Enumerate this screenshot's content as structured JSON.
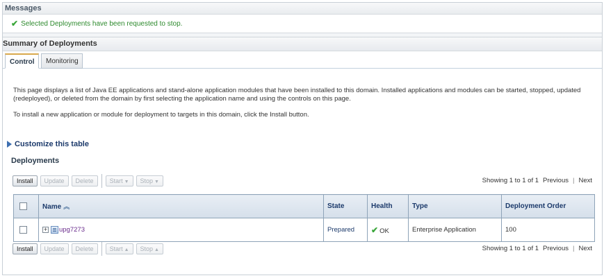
{
  "messages": {
    "header": "Messages",
    "text": "Selected Deployments have been requested to stop."
  },
  "summary": {
    "header": "Summary of Deployments",
    "tabs": [
      {
        "label": "Control",
        "active": true
      },
      {
        "label": "Monitoring",
        "active": false
      }
    ]
  },
  "description": {
    "paragraph1": "This page displays a list of Java EE applications and stand-alone application modules that have been installed to this domain. Installed applications and modules can be started, stopped, updated (redeployed), or deleted from the domain by first selecting the application name and using the controls on this page.",
    "paragraph2": "To install a new application or module for deployment to targets in this domain, click the Install button."
  },
  "customize_label": "Customize this table",
  "deployments": {
    "title": "Deployments",
    "buttons": {
      "install": "Install",
      "update": "Update",
      "delete": "Delete",
      "start": "Start",
      "stop": "Stop"
    },
    "paging": {
      "showing": "Showing 1 to 1 of 1",
      "previous": "Previous",
      "next": "Next"
    },
    "columns": {
      "name": "Name",
      "state": "State",
      "health": "Health",
      "type": "Type",
      "order": "Deployment Order"
    },
    "rows": [
      {
        "name": "upg7273",
        "state": "Prepared",
        "health": "OK",
        "type": "Enterprise Application",
        "order": "100"
      }
    ]
  },
  "icons": {
    "success": "check-icon",
    "expand": "expand-plus-icon",
    "app": "application-icon",
    "sort": "sort-ascending-icon",
    "customize": "disclosure-triangle-icon"
  }
}
